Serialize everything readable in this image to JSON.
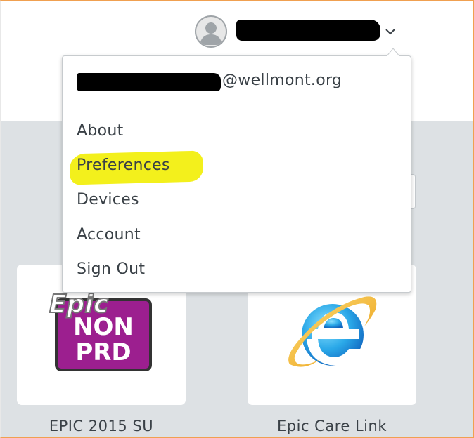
{
  "header": {
    "username_redacted": true
  },
  "user_menu": {
    "email_suffix": "@wellmont.org",
    "items": [
      {
        "label": "About"
      },
      {
        "label": "Preferences",
        "highlighted": true
      },
      {
        "label": "Devices"
      },
      {
        "label": "Account"
      },
      {
        "label": "Sign Out"
      }
    ],
    "highlight_color": "#f3f01c"
  },
  "apps": [
    {
      "label": "EPIC 2015 SU",
      "icon": "epic-nonprd-logo",
      "logo_text": [
        "Epic",
        "NON",
        "PRD"
      ]
    },
    {
      "label": "Epic Care Link",
      "icon": "internet-explorer-icon"
    }
  ],
  "colors": {
    "content_bg": "#dde1e4",
    "epic_purple": "#9c1f8f",
    "text": "#3a4147",
    "window_border": "#f0a050"
  }
}
